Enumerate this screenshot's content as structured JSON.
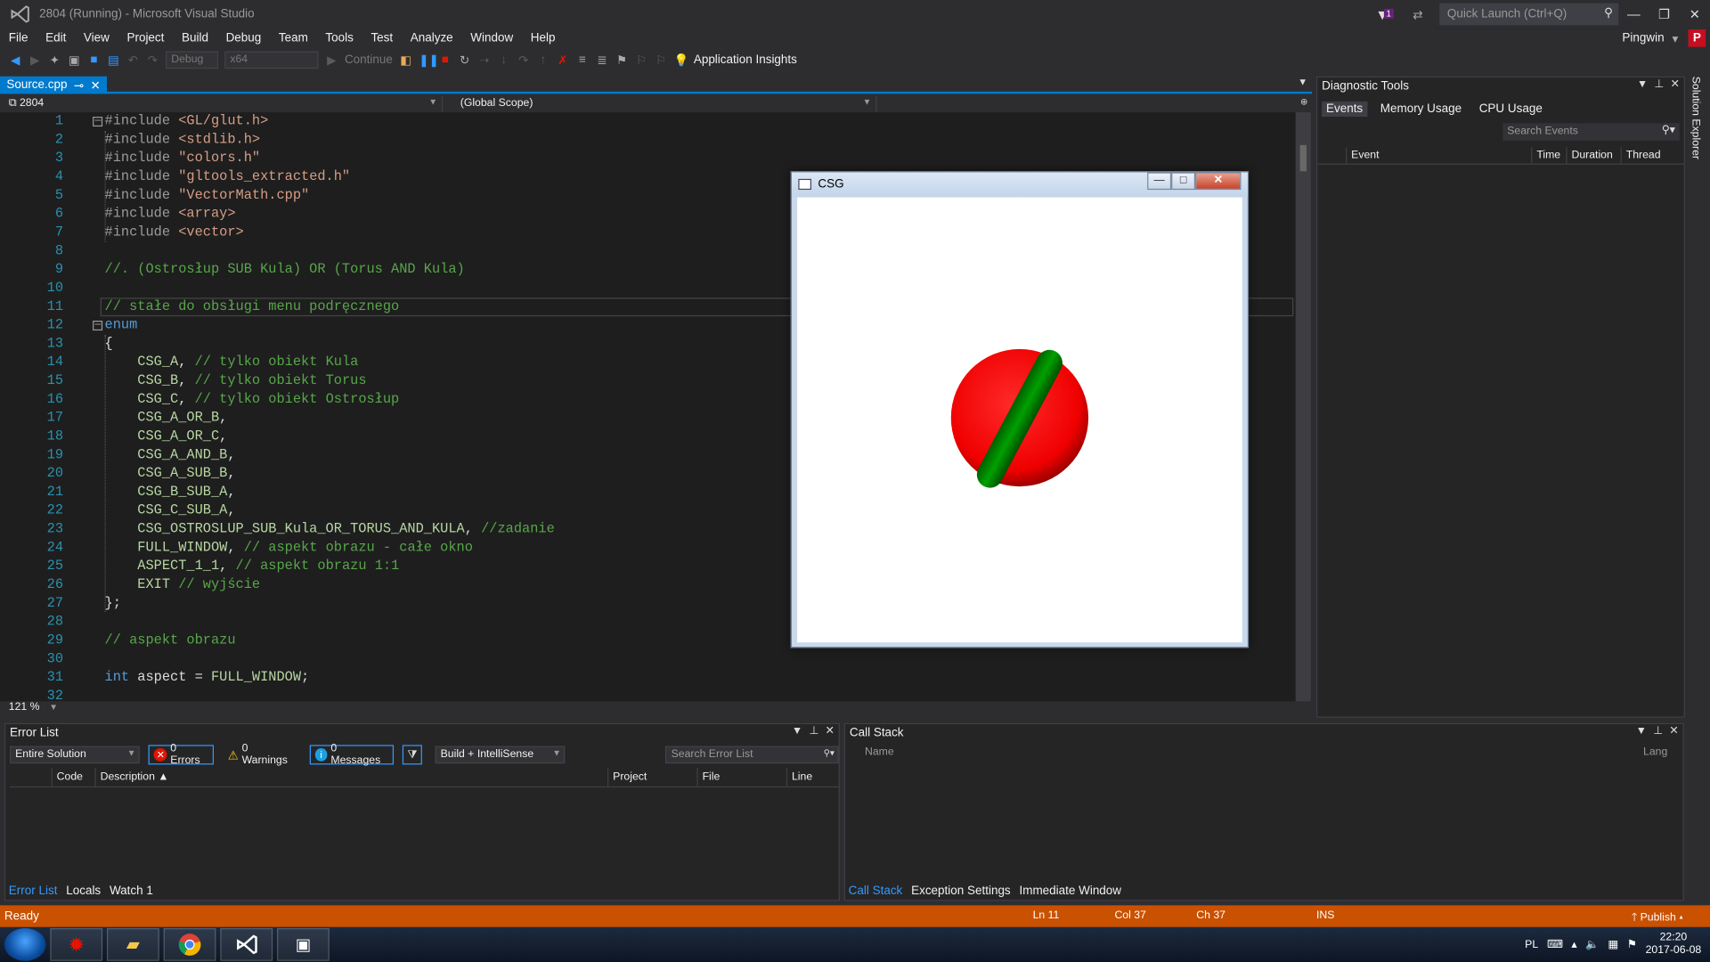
{
  "window": {
    "title": "2804 (Running) - Microsoft Visual Studio",
    "notification_count": "1",
    "quick_launch_placeholder": "Quick Launch (Ctrl+Q)",
    "user": "Pingwin",
    "user_initial": "P"
  },
  "menu": [
    "File",
    "Edit",
    "View",
    "Project",
    "Build",
    "Debug",
    "Team",
    "Tools",
    "Test",
    "Analyze",
    "Window",
    "Help"
  ],
  "toolbar": {
    "config": "Debug",
    "platform": "x64",
    "continue_label": "Continue",
    "app_insights": "Application Insights"
  },
  "editor": {
    "tab_label": "Source.cpp",
    "project_combo": "2804",
    "scope_combo": "(Global Scope)",
    "zoom": "121 %",
    "lines": [
      {
        "n": "1",
        "parts": [
          [
            "pp",
            "#include "
          ],
          [
            "str",
            "<GL/glut.h>"
          ]
        ],
        "fold": "−"
      },
      {
        "n": "2",
        "parts": [
          [
            "pp",
            "#include "
          ],
          [
            "str",
            "<stdlib.h>"
          ]
        ]
      },
      {
        "n": "3",
        "parts": [
          [
            "pp",
            "#include "
          ],
          [
            "str",
            "\"colors.h\""
          ]
        ]
      },
      {
        "n": "4",
        "parts": [
          [
            "pp",
            "#include "
          ],
          [
            "str",
            "\"gltools_extracted.h\""
          ]
        ]
      },
      {
        "n": "5",
        "parts": [
          [
            "pp",
            "#include "
          ],
          [
            "str",
            "\"VectorMath.cpp\""
          ]
        ]
      },
      {
        "n": "6",
        "parts": [
          [
            "pp",
            "#include "
          ],
          [
            "str",
            "<array>"
          ]
        ]
      },
      {
        "n": "7",
        "parts": [
          [
            "pp",
            "#include "
          ],
          [
            "str",
            "<vector>"
          ]
        ]
      },
      {
        "n": "8",
        "parts": []
      },
      {
        "n": "9",
        "parts": [
          [
            "com",
            "//. (Ostrosłup SUB Kula) OR (Torus AND Kula)"
          ]
        ]
      },
      {
        "n": "10",
        "parts": []
      },
      {
        "n": "11",
        "parts": [
          [
            "com",
            "// stałe do obsługi menu podręcznego"
          ]
        ],
        "current": true
      },
      {
        "n": "12",
        "parts": [
          [
            "kw",
            "enum"
          ]
        ],
        "fold": "−"
      },
      {
        "n": "13",
        "parts": [
          [
            "plain",
            "{"
          ]
        ]
      },
      {
        "n": "14",
        "parts": [
          [
            "enum",
            "    CSG_A"
          ],
          [
            "plain",
            ", "
          ],
          [
            "com",
            "// tylko obiekt Kula"
          ]
        ]
      },
      {
        "n": "15",
        "parts": [
          [
            "enum",
            "    CSG_B"
          ],
          [
            "plain",
            ", "
          ],
          [
            "com",
            "// tylko obiekt Torus"
          ]
        ]
      },
      {
        "n": "16",
        "parts": [
          [
            "enum",
            "    CSG_C"
          ],
          [
            "plain",
            ", "
          ],
          [
            "com",
            "// tylko obiekt Ostrosłup"
          ]
        ]
      },
      {
        "n": "17",
        "parts": [
          [
            "enum",
            "    CSG_A_OR_B"
          ],
          [
            "plain",
            ","
          ]
        ]
      },
      {
        "n": "18",
        "parts": [
          [
            "enum",
            "    CSG_A_OR_C"
          ],
          [
            "plain",
            ","
          ]
        ]
      },
      {
        "n": "19",
        "parts": [
          [
            "enum",
            "    CSG_A_AND_B"
          ],
          [
            "plain",
            ","
          ]
        ]
      },
      {
        "n": "20",
        "parts": [
          [
            "enum",
            "    CSG_A_SUB_B"
          ],
          [
            "plain",
            ","
          ]
        ]
      },
      {
        "n": "21",
        "parts": [
          [
            "enum",
            "    CSG_B_SUB_A"
          ],
          [
            "plain",
            ","
          ]
        ]
      },
      {
        "n": "22",
        "parts": [
          [
            "enum",
            "    CSG_C_SUB_A"
          ],
          [
            "plain",
            ","
          ]
        ]
      },
      {
        "n": "23",
        "parts": [
          [
            "enum",
            "    CSG_OSTROSLUP_SUB_Kula_OR_TORUS_AND_KULA"
          ],
          [
            "plain",
            ", "
          ],
          [
            "com",
            "//zadanie"
          ]
        ]
      },
      {
        "n": "24",
        "parts": [
          [
            "enum",
            "    FULL_WINDOW"
          ],
          [
            "plain",
            ", "
          ],
          [
            "com",
            "// aspekt obrazu - całe okno"
          ]
        ]
      },
      {
        "n": "25",
        "parts": [
          [
            "enum",
            "    ASPECT_1_1"
          ],
          [
            "plain",
            ", "
          ],
          [
            "com",
            "// aspekt obrazu 1:1"
          ]
        ]
      },
      {
        "n": "26",
        "parts": [
          [
            "enum",
            "    EXIT"
          ],
          [
            "plain",
            " "
          ],
          [
            "com",
            "// wyjście"
          ]
        ]
      },
      {
        "n": "27",
        "parts": [
          [
            "plain",
            "};"
          ]
        ]
      },
      {
        "n": "28",
        "parts": []
      },
      {
        "n": "29",
        "parts": [
          [
            "com",
            "// aspekt obrazu"
          ]
        ]
      },
      {
        "n": "30",
        "parts": []
      },
      {
        "n": "31",
        "parts": [
          [
            "kw",
            "int"
          ],
          [
            "plain",
            " aspect = "
          ],
          [
            "enum",
            "FULL_WINDOW"
          ],
          [
            "plain",
            ";"
          ]
        ]
      },
      {
        "n": "32",
        "parts": []
      }
    ]
  },
  "diagnostic": {
    "title": "Diagnostic Tools",
    "tabs": [
      "Events",
      "Memory Usage",
      "CPU Usage"
    ],
    "search_placeholder": "Search Events",
    "columns": [
      "Event",
      "Time",
      "Duration",
      "Thread"
    ]
  },
  "solution_explorer": "Solution Explorer",
  "csg_window": {
    "title": "CSG",
    "sphere_color": "#ff0000",
    "torus_color": "#008000"
  },
  "error_list": {
    "title": "Error List",
    "scope": "Entire Solution",
    "errors": "0 Errors",
    "warnings": "0 Warnings",
    "messages": "0 Messages",
    "build_filter": "Build + IntelliSense",
    "search_placeholder": "Search Error List",
    "columns": [
      "Code",
      "Description",
      "Project",
      "File",
      "Line"
    ]
  },
  "bottom_left_tabs": [
    "Error List",
    "Locals",
    "Watch 1"
  ],
  "call_stack": {
    "title": "Call Stack",
    "col_name": "Name",
    "col_lang": "Lang"
  },
  "bottom_right_tabs": [
    "Call Stack",
    "Exception Settings",
    "Immediate Window"
  ],
  "status": {
    "ready": "Ready",
    "ln": "Ln 11",
    "col": "Col 37",
    "ch": "Ch 37",
    "ins": "INS",
    "publish": "Publish"
  },
  "taskbar": {
    "lang": "PL",
    "time": "22:20",
    "date": "2017-06-08"
  }
}
